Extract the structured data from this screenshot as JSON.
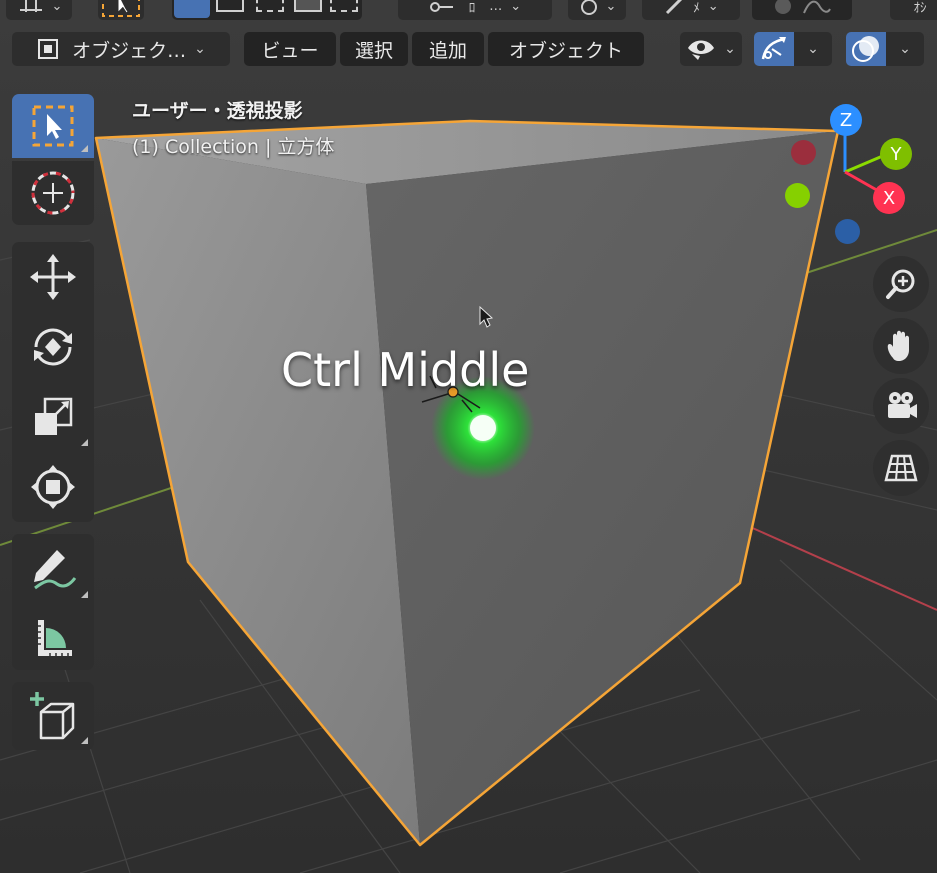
{
  "colors": {
    "viewport_bg": "#3a3a3a",
    "selection_outline": "#f5a537",
    "active_blue": "#4772b3",
    "axis_x": "#ff3352",
    "axis_y": "#8bdc00",
    "axis_z": "#2c8fff",
    "light_glow": "#22dd33"
  },
  "top_strip": {
    "pivot_label": "ﾛ",
    "pivot_dots": "…",
    "snap_label": "ﾒ",
    "right_label": "ｵｼ"
  },
  "header": {
    "mode_label": "オブジェク…",
    "menu": [
      "ビュー",
      "選択",
      "追加",
      "オブジェクト"
    ],
    "icons": [
      "object-mode-icon",
      "eye-visibility-icon",
      "gizmo-toggle-icon",
      "overlay-toggle-icon"
    ]
  },
  "viewport": {
    "view_title": "ユーザー・透視投影",
    "view_subtitle": "(1) Collection | 立方体",
    "keystroke_display": "Ctrl Middle"
  },
  "toolbar": {
    "tools": [
      "select-box",
      "cursor",
      "move",
      "rotate",
      "scale",
      "transform",
      "annotate",
      "measure",
      "add-cube"
    ],
    "active_tool": "select-box"
  },
  "gizmo": {
    "labels": {
      "z": "Z",
      "y": "Y",
      "x": "X"
    }
  },
  "navigation": [
    "zoom-icon",
    "hand-pan-icon",
    "camera-icon",
    "grid-perspective-icon"
  ]
}
